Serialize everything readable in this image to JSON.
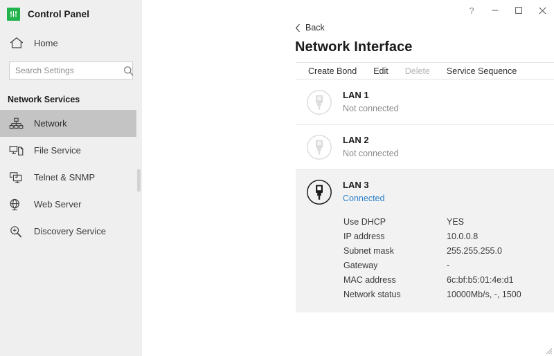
{
  "sidebar": {
    "brand": {
      "title": "Control Panel",
      "icon": "sliders-icon",
      "color": "#22b34c"
    },
    "home": {
      "label": "Home",
      "icon": "home-icon"
    },
    "search": {
      "placeholder": "Search Settings",
      "value": "",
      "icon": "search-icon"
    },
    "section_title": "Network Services",
    "items": [
      {
        "label": "Network",
        "icon": "network-topology-icon",
        "selected": true
      },
      {
        "label": "File Service",
        "icon": "file-service-icon",
        "selected": false
      },
      {
        "label": "Telnet & SNMP",
        "icon": "telnet-snmp-icon",
        "selected": false
      },
      {
        "label": "Web Server",
        "icon": "web-server-icon",
        "selected": false
      },
      {
        "label": "Discovery Service",
        "icon": "discovery-search-icon",
        "selected": false
      }
    ]
  },
  "window": {
    "help_label": "?",
    "minimize_label": "minimize-icon",
    "maximize_label": "maximize-icon",
    "close_label": "close-icon"
  },
  "main": {
    "back_label": "Back",
    "page_title": "Network Interface",
    "toolbar": [
      {
        "label": "Create Bond",
        "disabled": false
      },
      {
        "label": "Edit",
        "disabled": false
      },
      {
        "label": "Delete",
        "disabled": true
      },
      {
        "label": "Service Sequence",
        "disabled": false
      }
    ],
    "interfaces": [
      {
        "name": "LAN 1",
        "status": "Not connected",
        "connected": false,
        "expanded": false,
        "icon": "ethernet-port-icon",
        "chevron": "chevron-down-icon"
      },
      {
        "name": "LAN 2",
        "status": "Not connected",
        "connected": false,
        "expanded": false,
        "icon": "ethernet-port-icon",
        "chevron": "chevron-down-icon"
      },
      {
        "name": "LAN 3",
        "status": "Connected",
        "connected": true,
        "expanded": true,
        "icon": "ethernet-port-icon",
        "chevron": "chevron-up-icon",
        "details": [
          {
            "key": "Use DHCP",
            "value": "YES"
          },
          {
            "key": "IP address",
            "value": "10.0.0.8"
          },
          {
            "key": "Subnet mask",
            "value": "255.255.255.0"
          },
          {
            "key": "Gateway",
            "value": "-"
          },
          {
            "key": "MAC address",
            "value": "6c:bf:b5:01:4e:d1"
          },
          {
            "key": "Network status",
            "value": "10000Mb/s, -, 1500"
          }
        ]
      }
    ]
  },
  "colors": {
    "sidebar_bg": "#efefef",
    "selected_row": "#c4c4c4",
    "accent_link": "#2a7fc9",
    "brand_green": "#22b34c",
    "expanded_panel": "#f2f2f2"
  }
}
